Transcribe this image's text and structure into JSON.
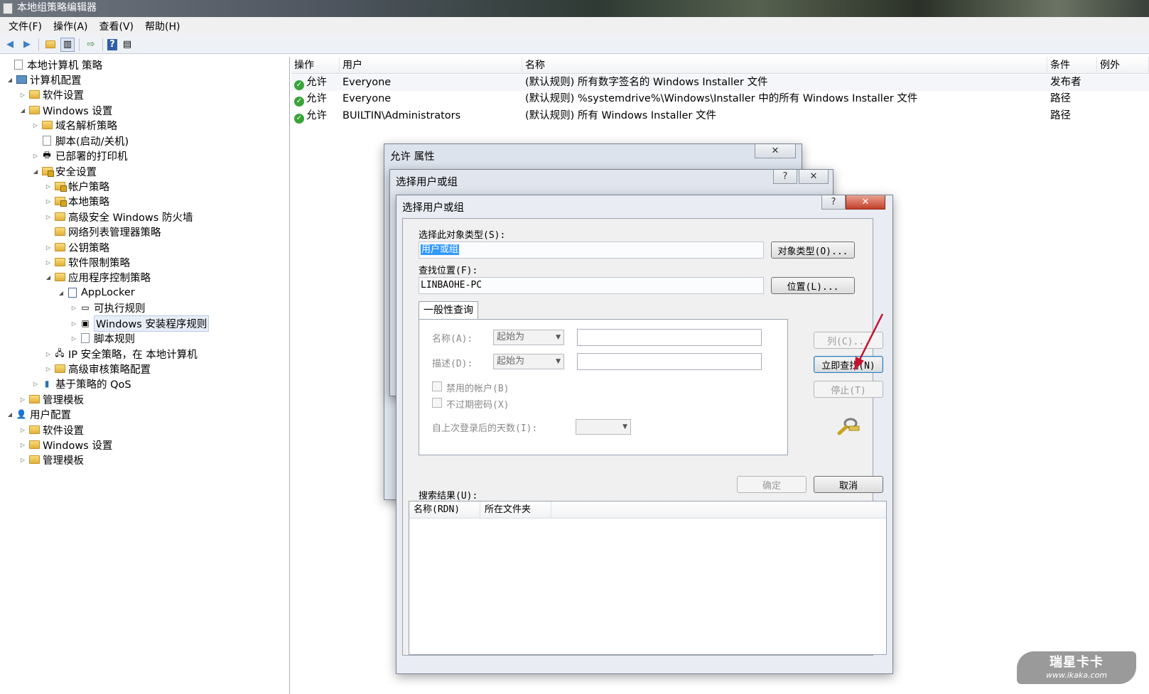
{
  "window": {
    "title": "本地组策略编辑器"
  },
  "menu": [
    "文件(F)",
    "操作(A)",
    "查看(V)",
    "帮助(H)"
  ],
  "tree": [
    {
      "label": "本地计算机 策略",
      "icon": "policy-doc-icon",
      "expander": ""
    },
    {
      "label": "计算机配置",
      "icon": "computer-icon",
      "expander": "◢"
    },
    {
      "label": "软件设置",
      "icon": "folder-icon",
      "expander": "▷"
    },
    {
      "label": "Windows 设置",
      "icon": "folder-icon",
      "expander": "◢"
    },
    {
      "label": "域名解析策略",
      "icon": "folder-icon",
      "expander": "▷"
    },
    {
      "label": "脚本(启动/关机)",
      "icon": "script-icon",
      "expander": ""
    },
    {
      "label": "已部署的打印机",
      "icon": "printer-icon",
      "expander": "▷"
    },
    {
      "label": "安全设置",
      "icon": "security-settings-icon",
      "expander": "◢"
    },
    {
      "label": "帐户策略",
      "icon": "locked-folder-icon",
      "expander": "▷"
    },
    {
      "label": "本地策略",
      "icon": "locked-folder-icon",
      "expander": "▷"
    },
    {
      "label": "高级安全 Windows 防火墙",
      "icon": "folder-icon",
      "expander": "▷"
    },
    {
      "label": "网络列表管理器策略",
      "icon": "folder-icon",
      "expander": ""
    },
    {
      "label": "公钥策略",
      "icon": "folder-icon",
      "expander": "▷"
    },
    {
      "label": "软件限制策略",
      "icon": "folder-icon",
      "expander": "▷"
    },
    {
      "label": "应用程序控制策略",
      "icon": "folder-icon",
      "expander": "◢"
    },
    {
      "label": "AppLocker",
      "icon": "applocker-icon",
      "expander": "◢"
    },
    {
      "label": "可执行规则",
      "icon": "executable-rules-icon",
      "expander": "▷"
    },
    {
      "label": "Windows 安装程序规则",
      "icon": "installer-rules-icon",
      "expander": "▷"
    },
    {
      "label": "脚本规则",
      "icon": "script-rules-icon",
      "expander": "▷"
    },
    {
      "label": "IP 安全策略，在 本地计算机",
      "icon": "ip-security-icon",
      "expander": "▷"
    },
    {
      "label": "高级审核策略配置",
      "icon": "folder-icon",
      "expander": "▷"
    },
    {
      "label": "基于策略的 QoS",
      "icon": "qos-chart-icon",
      "expander": "▷"
    },
    {
      "label": "管理模板",
      "icon": "folder-icon",
      "expander": "▷"
    },
    {
      "label": "用户配置",
      "icon": "user-icon",
      "expander": "◢"
    },
    {
      "label": "软件设置",
      "icon": "folder-icon",
      "expander": "▷"
    },
    {
      "label": "Windows 设置",
      "icon": "folder-icon",
      "expander": "▷"
    },
    {
      "label": "管理模板",
      "icon": "folder-icon",
      "expander": "▷"
    }
  ],
  "list": {
    "headers": [
      "操作",
      "用户",
      "名称",
      "条件",
      "例外"
    ],
    "rows": [
      {
        "action": "允许",
        "user": "Everyone",
        "name": "(默认规则) 所有数字签名的 Windows Installer 文件",
        "condition": "发布者"
      },
      {
        "action": "允许",
        "user": "Everyone",
        "name": "(默认规则) %systemdrive%\\Windows\\Installer 中的所有 Windows Installer 文件",
        "condition": "路径"
      },
      {
        "action": "允许",
        "user": "BUILTIN\\Administrators",
        "name": "(默认规则) 所有 Windows Installer 文件",
        "condition": "路径"
      }
    ]
  },
  "dialog_props": {
    "title": "允许 属性"
  },
  "dialog_select_back": {
    "title": "选择用户或组"
  },
  "dialog_select": {
    "title": "选择用户或组",
    "help_glyph": "?",
    "close_glyph": "✕",
    "object_type_label": "选择此对象类型(S):",
    "object_type_value": "用户或组",
    "object_type_button": "对象类型(O)...",
    "location_label": "查找位置(F):",
    "location_value": "LINBAOHE-PC",
    "location_button": "位置(L)...",
    "tab_label": "一般性查询",
    "name_label": "名称(A):",
    "name_op": "起始为",
    "desc_label": "描述(D):",
    "desc_op": "起始为",
    "disabled_accounts": "禁用的帐户(B)",
    "no_expire": "不过期密码(X)",
    "days_label": "自上次登录后的天数(I):",
    "columns_button": "列(C)...",
    "find_now_button": "立即查找(N)",
    "stop_button": "停止(T)",
    "ok_button": "确定",
    "cancel_button": "取消",
    "results_label": "搜索结果(U):",
    "results_headers": [
      "名称(RDN)",
      "所在文件夹"
    ]
  },
  "watermark": {
    "main": "瑞星卡卡",
    "sub": "www.ikaka.com"
  },
  "colors": {
    "accent_arrow": "#c8102e",
    "selection": "#3399ff",
    "allow_icon": "#3aa33a"
  }
}
